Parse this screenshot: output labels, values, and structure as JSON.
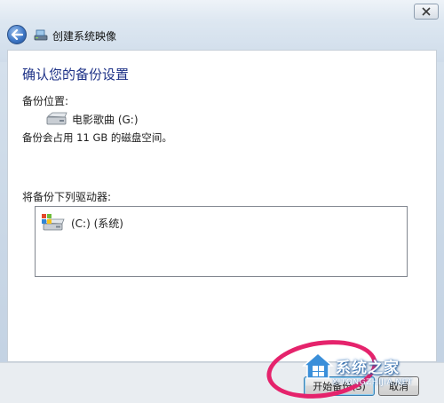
{
  "window": {
    "title": "创建系统映像"
  },
  "main": {
    "heading": "确认您的备份设置",
    "backup_location_label": "备份位置:",
    "target_drive": "电影歌曲 (G:)",
    "space_note": "备份会占用 11 GB 的磁盘空间。",
    "backup_drives_label": "将备份下列驱动器:",
    "drives": [
      {
        "name": "(C:) (系统)"
      }
    ]
  },
  "footer": {
    "start_label": "开始备份(S)",
    "cancel_label": "取消"
  },
  "watermark": {
    "brand": "系统之家",
    "url": "XITONGZHIJIA.NET"
  },
  "colors": {
    "heading": "#1e3287",
    "annotation_circle": "#e5236c"
  }
}
